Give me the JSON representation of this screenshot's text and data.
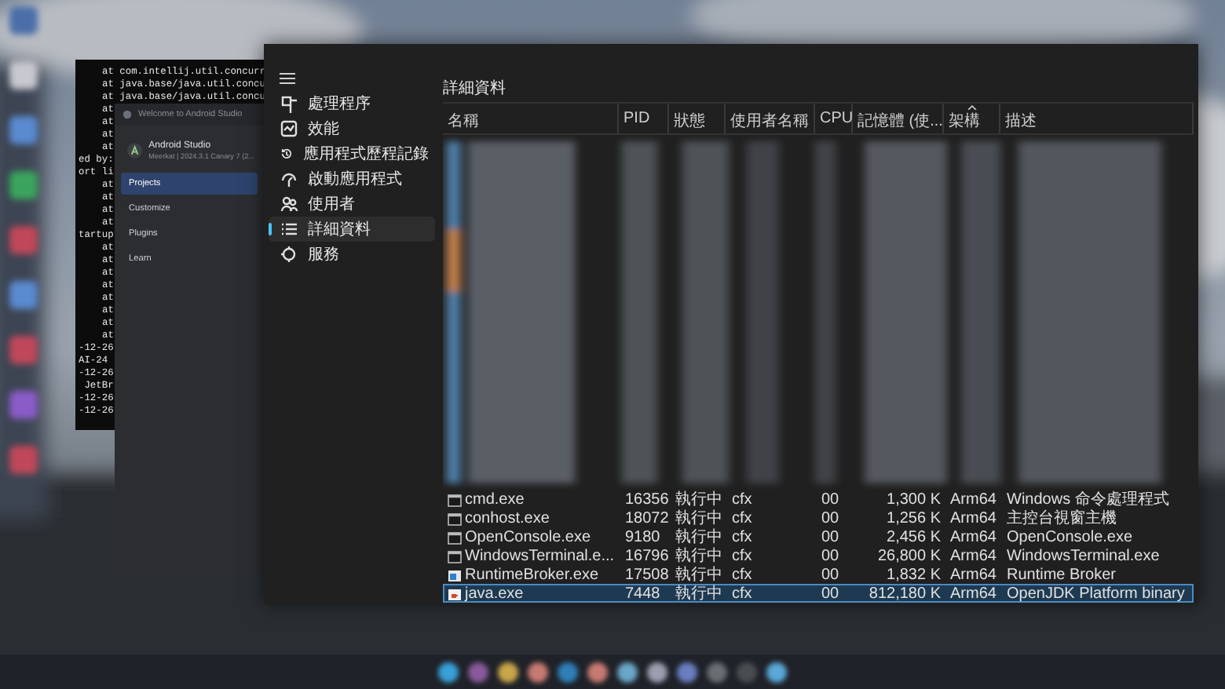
{
  "terminal": {
    "lines": [
      {
        "kind": "frame",
        "text": "at com.intellij.util.concurr"
      },
      {
        "kind": "frame",
        "text": "at java.base/java.util.concu"
      },
      {
        "kind": "frame",
        "text": "at java.base/java.util.concu"
      },
      {
        "kind": "frame",
        "text": "at"
      },
      {
        "kind": "frame",
        "text": "at"
      },
      {
        "kind": "frame",
        "text": "at"
      },
      {
        "kind": "frame",
        "text": "at"
      },
      {
        "kind": "text",
        "text": "ed by:"
      },
      {
        "kind": "text",
        "text": "ort li"
      },
      {
        "kind": "frame",
        "text": "at"
      },
      {
        "kind": "frame",
        "text": "at"
      },
      {
        "kind": "frame",
        "text": "at"
      },
      {
        "kind": "frame",
        "text": "at"
      },
      {
        "kind": "text",
        "text": "tartup"
      },
      {
        "kind": "frame",
        "text": "at"
      },
      {
        "kind": "frame",
        "text": "at"
      },
      {
        "kind": "frame",
        "text": "at"
      },
      {
        "kind": "frame",
        "text": "at"
      },
      {
        "kind": "frame",
        "text": "at"
      },
      {
        "kind": "frame",
        "text": "at"
      },
      {
        "kind": "frame",
        "text": "at"
      },
      {
        "kind": "frame",
        "text": "at"
      },
      {
        "kind": "text",
        "text": "-12-26"
      },
      {
        "kind": "text",
        "text": "AI-24"
      },
      {
        "kind": "text",
        "text": "-12-26"
      },
      {
        "kind": "text",
        "text": " JetBr"
      },
      {
        "kind": "text",
        "text": "-12-26"
      },
      {
        "kind": "text",
        "text": "-12-26"
      }
    ]
  },
  "android_studio": {
    "title": "Welcome to Android Studio",
    "app_name": "Android Studio",
    "version": "Meerkat | 2024.3.1 Canary 7 (2...",
    "nav": [
      {
        "label": "Projects",
        "selected": true
      },
      {
        "label": "Customize",
        "selected": false
      },
      {
        "label": "Plugins",
        "selected": false
      },
      {
        "label": "Learn",
        "selected": false
      }
    ]
  },
  "task_manager": {
    "sidebar": [
      {
        "kind": "processes",
        "label": "處理程序",
        "selected": false
      },
      {
        "kind": "performance",
        "label": "效能",
        "selected": false
      },
      {
        "kind": "history",
        "label": "應用程式歷程記錄",
        "selected": false
      },
      {
        "kind": "startup",
        "label": "啟動應用程式",
        "selected": false
      },
      {
        "kind": "users",
        "label": "使用者",
        "selected": false
      },
      {
        "kind": "details",
        "label": "詳細資料",
        "selected": true
      },
      {
        "kind": "services",
        "label": "服務",
        "selected": false
      }
    ],
    "page_title": "詳細資料",
    "columns": [
      {
        "label": "名稱",
        "sorted": false
      },
      {
        "label": "PID",
        "sorted": false
      },
      {
        "label": "狀態",
        "sorted": false
      },
      {
        "label": "使用者名稱",
        "sorted": false
      },
      {
        "label": "CPU",
        "sorted": false
      },
      {
        "label": "記憶體 (使...",
        "sorted": false
      },
      {
        "label": "架構",
        "sorted": true
      },
      {
        "label": "描述",
        "sorted": false
      }
    ],
    "rows": [
      {
        "kind": "console",
        "name": "cmd.exe",
        "pid": "16356",
        "status": "執行中",
        "user": "cfx",
        "cpu": "00",
        "memory": "1,300 K",
        "arch": "Arm64",
        "description": "Windows 命令處理程式",
        "selected": false
      },
      {
        "kind": "console",
        "name": "conhost.exe",
        "pid": "18072",
        "status": "執行中",
        "user": "cfx",
        "cpu": "00",
        "memory": "1,256 K",
        "arch": "Arm64",
        "description": "主控台視窗主機",
        "selected": false
      },
      {
        "kind": "console",
        "name": "OpenConsole.exe",
        "pid": "9180",
        "status": "執行中",
        "user": "cfx",
        "cpu": "00",
        "memory": "2,456 K",
        "arch": "Arm64",
        "description": "OpenConsole.exe",
        "selected": false
      },
      {
        "kind": "console",
        "name": "WindowsTerminal.e...",
        "pid": "16796",
        "status": "執行中",
        "user": "cfx",
        "cpu": "00",
        "memory": "26,800 K",
        "arch": "Arm64",
        "description": "WindowsTerminal.exe",
        "selected": false
      },
      {
        "kind": "app",
        "name": "RuntimeBroker.exe",
        "pid": "17508",
        "status": "執行中",
        "user": "cfx",
        "cpu": "00",
        "memory": "1,832 K",
        "arch": "Arm64",
        "description": "Runtime Broker",
        "selected": false
      },
      {
        "kind": "java",
        "name": "java.exe",
        "pid": "7448",
        "status": "執行中",
        "user": "cfx",
        "cpu": "00",
        "memory": "812,180 K",
        "arch": "Arm64",
        "description": "OpenJDK Platform binary",
        "selected": true
      }
    ]
  }
}
